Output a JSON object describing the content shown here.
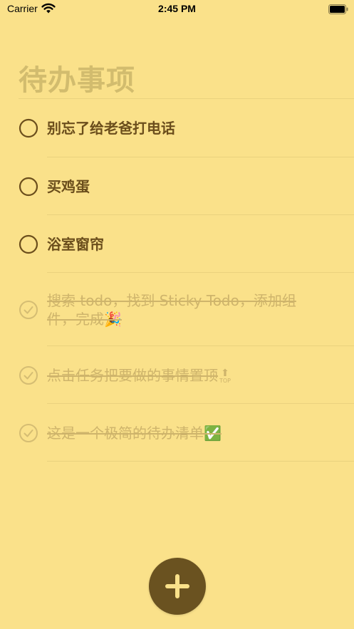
{
  "status_bar": {
    "carrier": "Carrier",
    "time": "2:45 PM",
    "wifi_icon": "wifi-icon",
    "battery_icon": "battery-icon"
  },
  "page": {
    "title": "待办事项"
  },
  "todos": [
    {
      "text": "别忘了给老爸打电话",
      "done": false
    },
    {
      "text": "买鸡蛋",
      "done": false
    },
    {
      "text": "浴室窗帘",
      "done": false
    },
    {
      "text": "搜索 todo，找到 Sticky Todo，添加组件，完成🎉",
      "done": true
    },
    {
      "text": "点击任务把要做的事情置顶",
      "done": true,
      "badge": "TOP"
    },
    {
      "text": "这是一个极简的待办清单✅",
      "done": true
    }
  ],
  "add_button": {
    "icon": "plus-icon"
  },
  "colors": {
    "background": "#FAE18A",
    "text_active": "#6B4E1C",
    "text_done": "#CEB46B",
    "title": "#D2BC6E",
    "button": "#6A5220"
  }
}
